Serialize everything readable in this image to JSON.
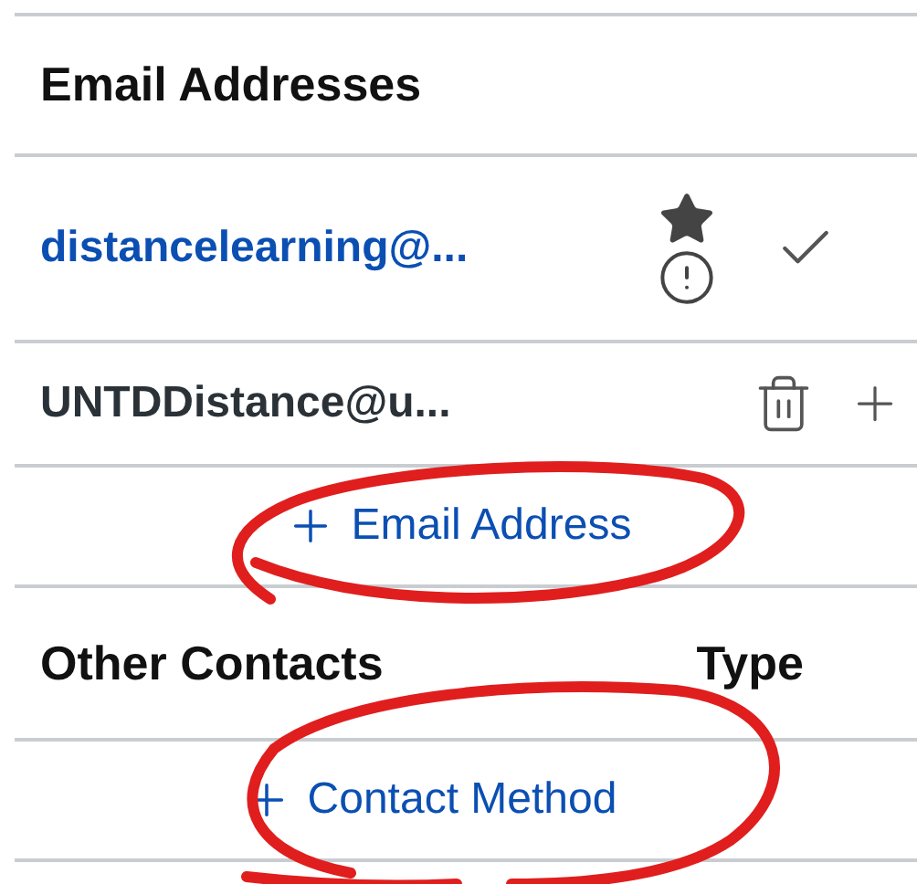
{
  "email_section": {
    "title": "Email Addresses",
    "emails": [
      {
        "address": "distancelearning@...",
        "primary": true
      },
      {
        "address": "UNTDDistance@u...",
        "primary": false
      }
    ],
    "add_button": "Email Address"
  },
  "contacts_section": {
    "columns": [
      "Other Contacts",
      "Type"
    ],
    "add_button": "Contact Method"
  }
}
